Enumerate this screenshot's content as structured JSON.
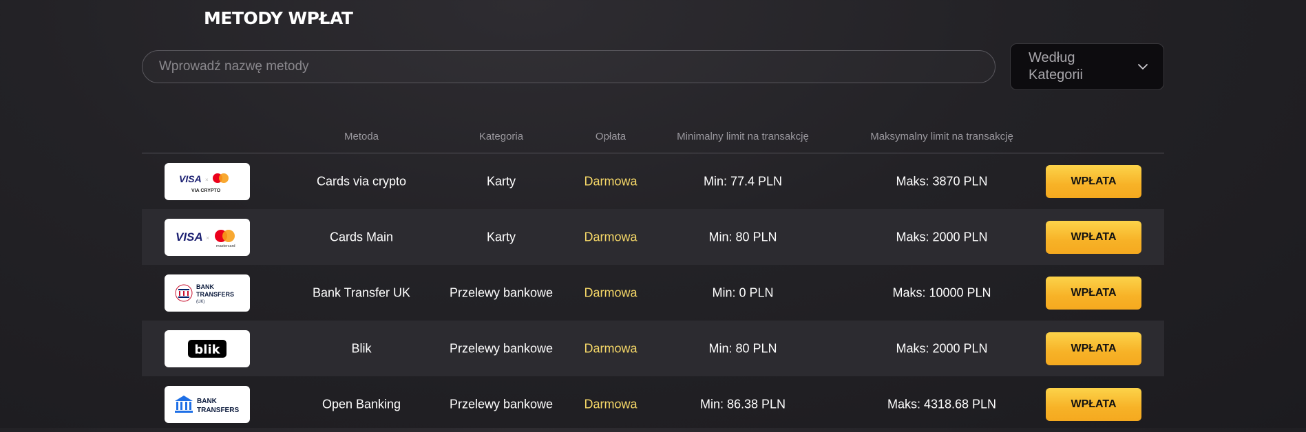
{
  "page": {
    "title": "METODY WPŁAT"
  },
  "search": {
    "placeholder": "Wprowadź nazwę metody",
    "value": ""
  },
  "category_filter": {
    "selected": "Według Kategorii",
    "icon": "chevron-down-icon"
  },
  "table": {
    "headers": {
      "method": "Metoda",
      "category": "Kategoria",
      "fee": "Opłata",
      "min_limit": "Minimalny limit na transakcję",
      "max_limit": "Maksymalny limit na transakcję"
    },
    "rows": [
      {
        "logo": "visa-mastercard-crypto-logo",
        "logo_text": [
          "VISA",
          "VIA CRYPTO"
        ],
        "method": "Cards via crypto",
        "category": "Karty",
        "fee": "Darmowa",
        "min": "Min: 77.4 PLN",
        "max": "Maks: 3870 PLN",
        "button": "WPŁATA"
      },
      {
        "logo": "visa-mastercard-logo",
        "logo_text": [
          "VISA",
          "mastercard"
        ],
        "method": "Cards Main",
        "category": "Karty",
        "fee": "Darmowa",
        "min": "Min: 80 PLN",
        "max": "Maks: 2000 PLN",
        "button": "WPŁATA"
      },
      {
        "logo": "bank-transfers-uk-logo",
        "logo_text": [
          "BANK",
          "TRANSFERS",
          "(UK)"
        ],
        "method": "Bank Transfer UK",
        "category": "Przelewy bankowe",
        "fee": "Darmowa",
        "min": "Min: 0 PLN",
        "max": "Maks: 10000 PLN",
        "button": "WPŁATA"
      },
      {
        "logo": "blik-logo",
        "logo_text": [
          "blik"
        ],
        "method": "Blik",
        "category": "Przelewy bankowe",
        "fee": "Darmowa",
        "min": "Min: 80 PLN",
        "max": "Maks: 2000 PLN",
        "button": "WPŁATA"
      },
      {
        "logo": "bank-transfers-logo",
        "logo_text": [
          "BANK",
          "TRANSFERS"
        ],
        "method": "Open Banking",
        "category": "Przelewy bankowe",
        "fee": "Darmowa",
        "min": "Min: 86.38 PLN",
        "max": "Maks: 4318.68 PLN",
        "button": "WPŁATA"
      }
    ]
  },
  "colors": {
    "fee_free": "#f7d968",
    "button_gradient_top": "#fcd34a",
    "button_gradient_bottom": "#f5a91f",
    "row_alt": "#2c2b30"
  }
}
